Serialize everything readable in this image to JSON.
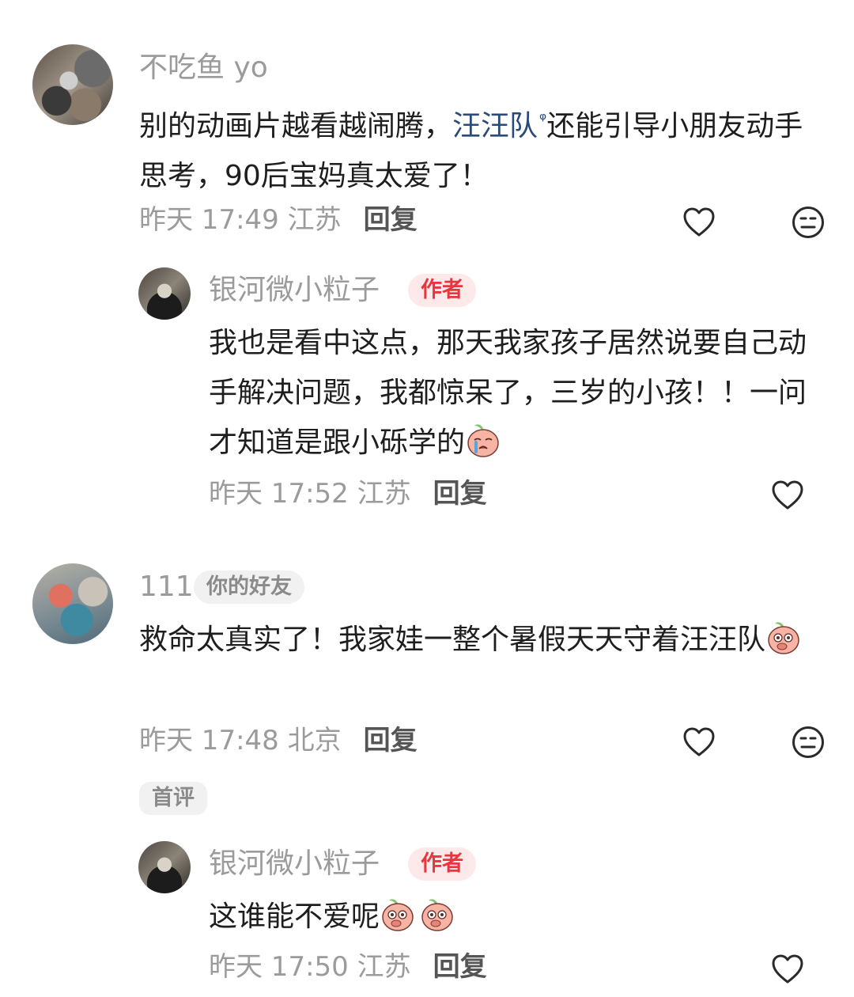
{
  "comments": [
    {
      "user": "不吃鱼 yo",
      "text_before": "别的动画片越看越闹腾，",
      "highlight": "汪汪队",
      "search_marker": "ᵠ",
      "text_after": "还能引导小朋友动手思考，90后宝妈真太爱了！",
      "time_location": "昨天 17:49 江苏",
      "reply_label": "回复",
      "reply": {
        "user": "银河微小粒子",
        "badge": "作者",
        "text": "我也是看中这点，那天我家孩子居然说要自己动手解决问题，我都惊呆了，三岁的小孩！！一问才知道是跟小砾学的",
        "emoji": "crying-emoji",
        "time_location": "昨天 17:52 江苏",
        "reply_label": "回复"
      }
    },
    {
      "user": "111",
      "friend_badge": "你的好友",
      "text": "救命太真实了！我家娃一整个暑假天天守着汪汪队",
      "emoji": "peach-emoji",
      "time_location": "昨天 17:48 北京",
      "reply_label": "回复",
      "first_badge": "首评",
      "reply": {
        "user": "银河微小粒子",
        "badge": "作者",
        "text": "这谁能不爱呢",
        "emoji": "peach-emoji",
        "time_location": "昨天 17:50 江苏",
        "reply_label": "回复"
      }
    }
  ],
  "icons": {
    "like": "heart-outline-icon",
    "dislike": "meh-face-icon"
  },
  "colors": {
    "author_badge": "#e8363f",
    "highlight_link": "#2b4a78",
    "meta_text": "#9b9b9b"
  }
}
